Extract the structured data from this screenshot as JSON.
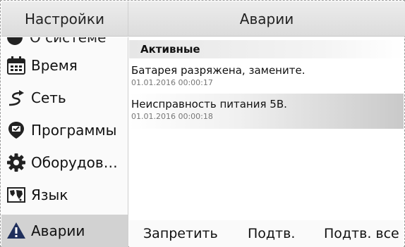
{
  "header": {
    "left_title": "Настройки",
    "right_title": "Аварии"
  },
  "sidebar": {
    "items": [
      {
        "label": "О системе",
        "icon": "info-icon"
      },
      {
        "label": "Время",
        "icon": "calendar-icon"
      },
      {
        "label": "Сеть",
        "icon": "network-icon"
      },
      {
        "label": "Программы",
        "icon": "program-icon"
      },
      {
        "label": "Оборудов…",
        "icon": "gear-icon"
      },
      {
        "label": "Язык",
        "icon": "globe-map-icon"
      },
      {
        "label": "Аварии",
        "icon": "warning-icon",
        "active": true
      }
    ]
  },
  "alarms": {
    "section_title": "Активные",
    "items": [
      {
        "message": "Батарея разряжена, замените.",
        "timestamp": "01.01.2016 00:00:17"
      },
      {
        "message": "Неисправность питания 5В.",
        "timestamp": "01.01.2016 00:00:18",
        "selected": true
      }
    ]
  },
  "toolbar": {
    "forbid_label": "Запретить",
    "ack_label": "Подтв.",
    "ack_all_label": "Подтв. все"
  },
  "colors": {
    "active_item_bg": "#d2d2d2",
    "warning_icon": "#1f2f5c"
  }
}
